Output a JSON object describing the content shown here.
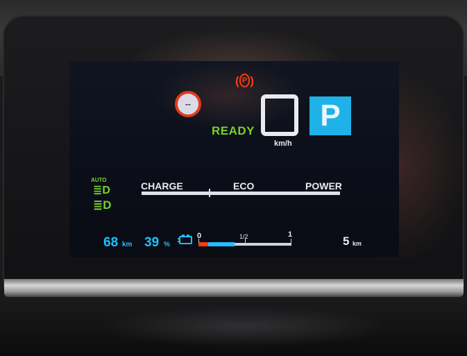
{
  "cluster": {
    "parking_brake": {
      "icon": "parking-brake-warning-icon",
      "letter": "P",
      "color": "#ff3a10"
    },
    "speed_limit": {
      "icon": "speed-limit-sign-icon",
      "value": "--"
    },
    "status": {
      "text": "READY",
      "color": "#7bd12b"
    },
    "speed": {
      "unit": "km/h"
    },
    "gear": {
      "value": "P",
      "color": "#1eb2e8"
    },
    "lights": {
      "auto_label": "AUTO",
      "auto_headlight_icon": "auto-headlight-icon",
      "headlight_icon": "low-beam-headlight-icon",
      "color": "#7bd12b"
    },
    "power_meter": {
      "labels": [
        "CHARGE",
        "ECO",
        "POWER"
      ]
    },
    "range": {
      "value": "68",
      "unit": "km"
    },
    "battery": {
      "percent": "39",
      "unit": "%",
      "icon": "battery-icon",
      "scale": [
        "0",
        "1/2",
        "1"
      ],
      "level_fraction": 0.39,
      "color": "#1ec0ff"
    },
    "trip": {
      "value": "5",
      "unit": "km"
    }
  }
}
